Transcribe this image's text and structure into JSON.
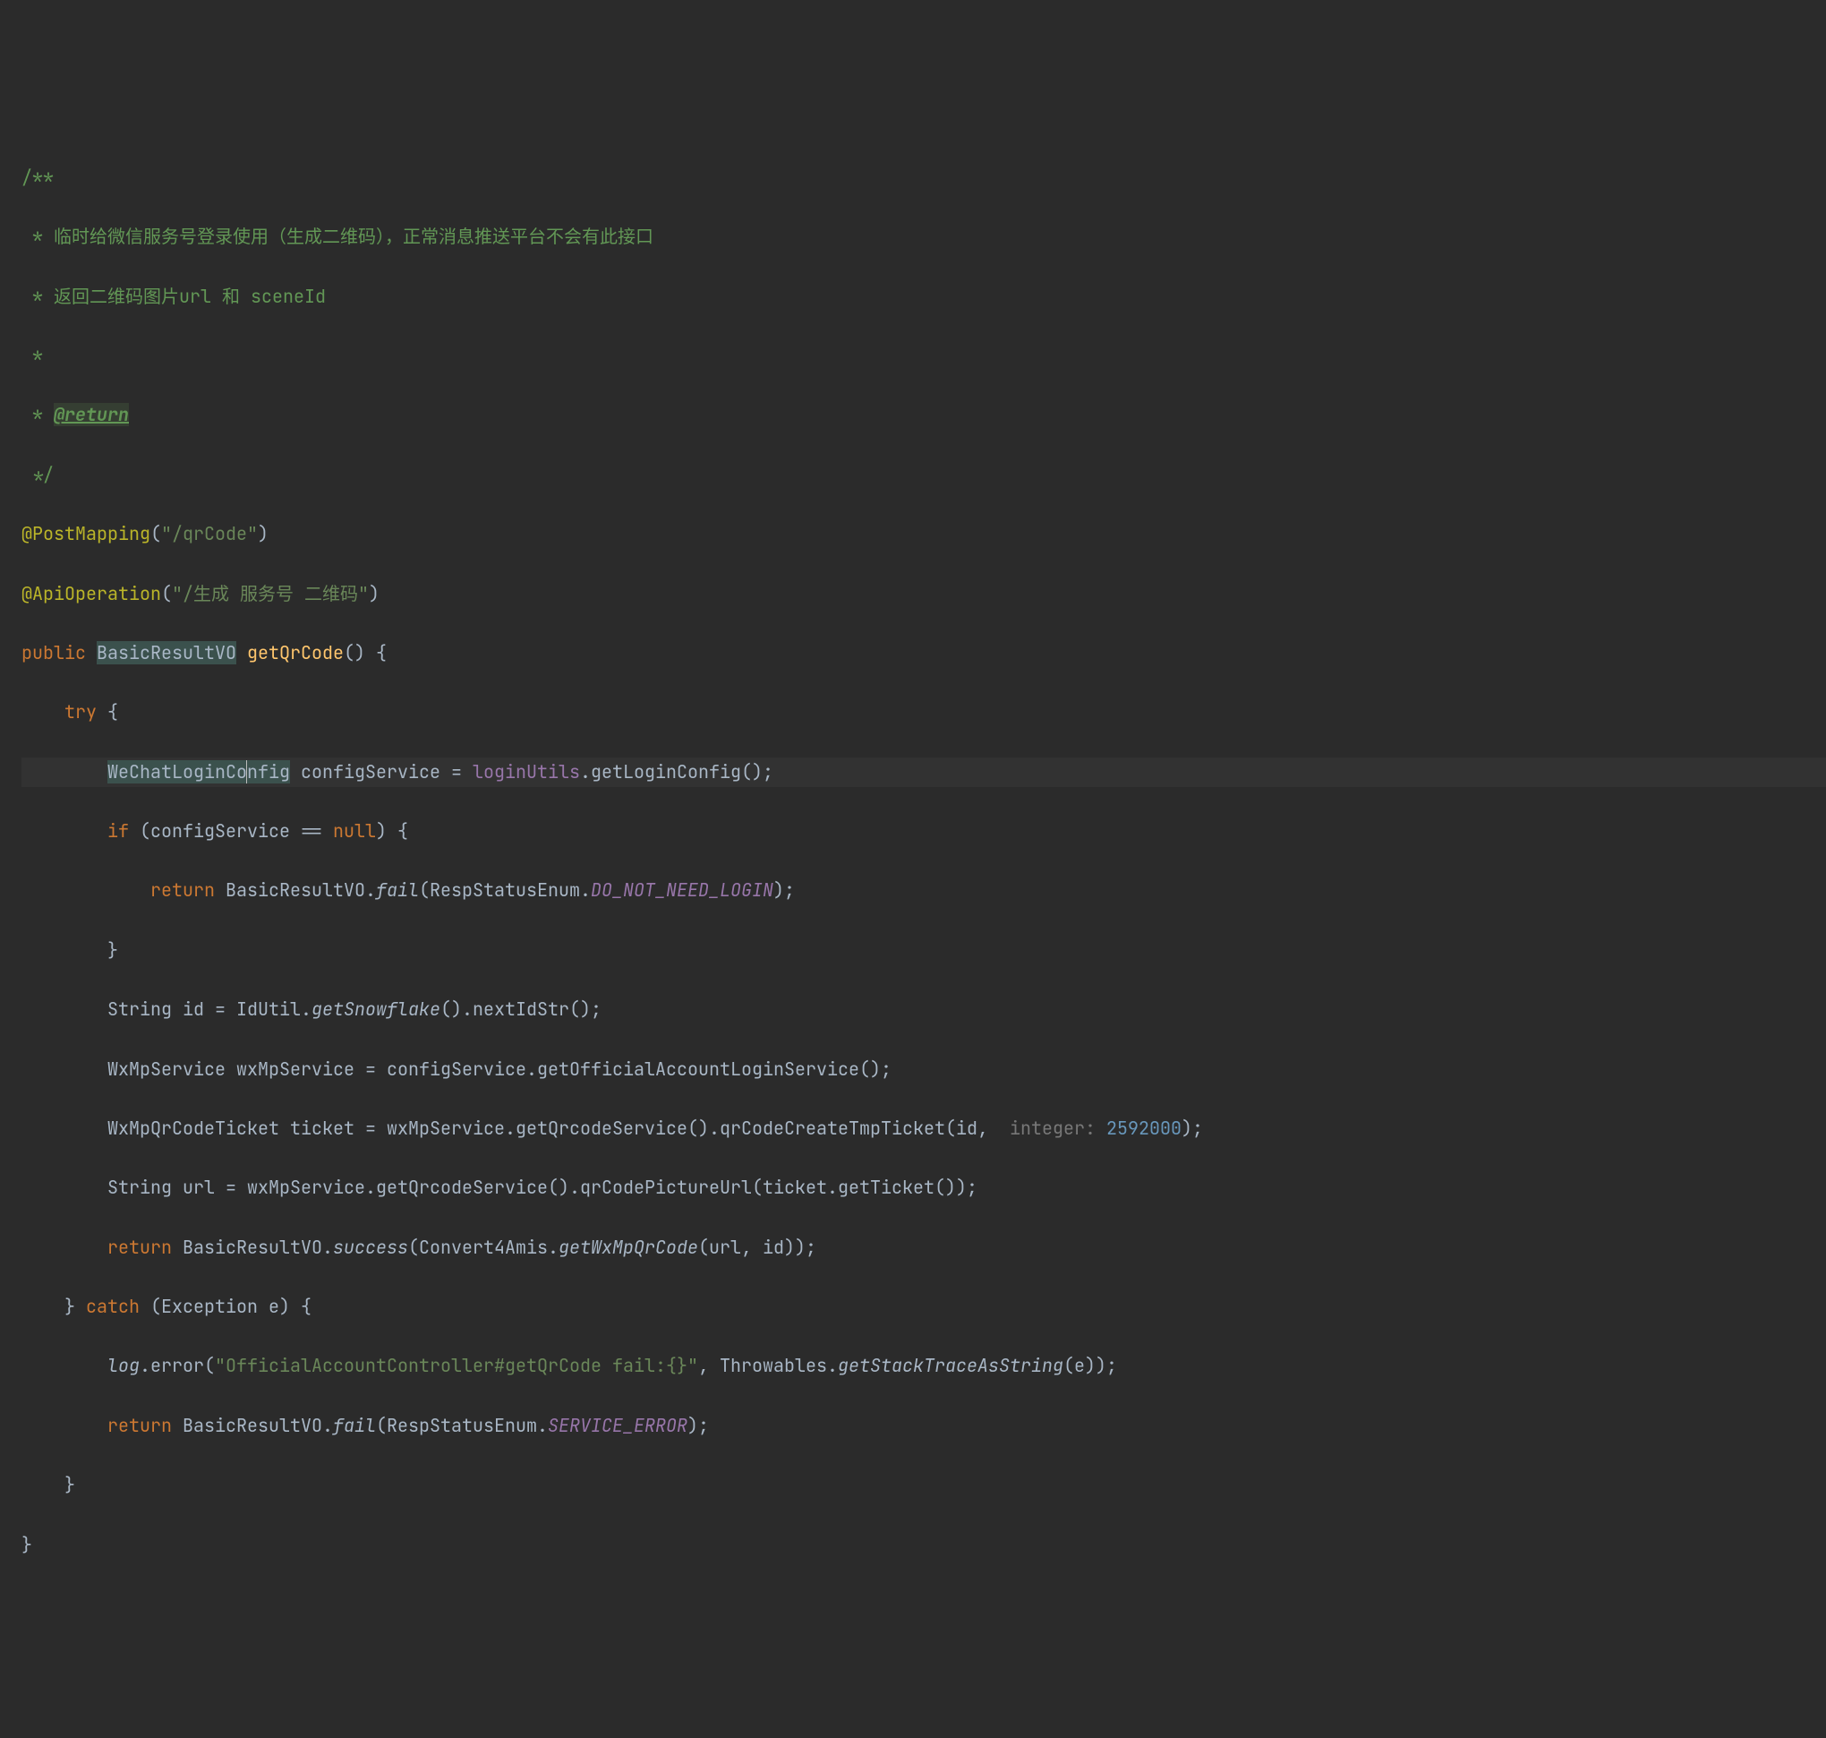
{
  "code": {
    "c1": "/**",
    "c2": " * 临时给微信服务号登录使用（生成二维码），正常消息推送平台不会有此接口",
    "c3": " * 返回二维码图片url 和 sceneId",
    "c4": " *",
    "c5a": " * ",
    "c5_tag": "@return",
    "c6": " */",
    "ann1": "@PostMapping",
    "ann1_lp": "(",
    "ann1_str": "\"/qrCode\"",
    "ann1_rp": ")",
    "ann2": "@ApiOperation",
    "ann2_lp": "(",
    "ann2_str": "\"/生成 服务号 二维码\"",
    "ann2_rp": ")",
    "kw_public": "public ",
    "type_BasicResultVO": "BasicResultVO",
    "sp1": " ",
    "m_getQrCode": "getQrCode",
    "sig_open": "() {",
    "indent1": "    ",
    "kw_try": "try",
    "brace_try": " {",
    "indent2": "        ",
    "type_WeChatLoginConfig_a": "WeChatLoginCo",
    "caret_marker": "",
    "type_WeChatLoginConfig_b": "nfig",
    "sp2": " ",
    "var_configService": "configService ",
    "eq1": "= ",
    "fld_loginUtils": "loginUtils",
    "dot1": ".",
    "call_getLoginConfig": "getLoginConfig();",
    "kw_if": "if ",
    "if_cond": "(configService == ",
    "kw_null": "null",
    "if_close": ") {",
    "indent3": "            ",
    "kw_return": "return ",
    "t_BasicResultVO": "BasicResultVO.",
    "sc_fail": "fail",
    "fail_args_open": "(RespStatusEnum.",
    "enum_DO_NOT_NEED_LOGIN": "DO_NOT_NEED_LOGIN",
    "fail_args_close": ");",
    "brace_close": "}",
    "line_id_a": "String id = IdUtil.",
    "sc_getSnowflake": "getSnowflake",
    "line_id_b": "().nextIdStr();",
    "line_wxsvc": "WxMpService wxMpService = configService.getOfficialAccountLoginService();",
    "line_ticket_a": "WxMpQrCodeTicket ticket = wxMpService.getQrcodeService().qrCodeCreateTmpTicket(id, ",
    "hint_integer": " integer: ",
    "num_2592000": "2592000",
    "line_ticket_b": ");",
    "line_url": "String url = wxMpService.getQrcodeService().qrCodePictureUrl(ticket.getTicket());",
    "kw_return2": "return ",
    "t_BasicResultVO2": "BasicResultVO.",
    "sc_success": "success",
    "succ_open": "(Convert4Amis.",
    "sc_getWxMpQrCode": "getWxMpQrCode",
    "succ_close": "(url, id));",
    "brace_close2": "} ",
    "kw_catch": "catch",
    "catch_args": " (Exception e) {",
    "fld_log": "log",
    "log_dot": ".error(",
    "str_log": "\"OfficialAccountController#getQrCode fail:{}\"",
    "log_mid": ", Throwables.",
    "sc_getStackTraceAsString": "getStackTraceAsString",
    "log_end": "(e));",
    "kw_return3": "return ",
    "t_BasicResultVO3": "BasicResultVO.",
    "sc_fail2": "fail",
    "fail2_open": "(RespStatusEnum.",
    "enum_SERVICE_ERROR": "SERVICE_ERROR",
    "fail2_close": ");",
    "brace_close3": "}",
    "brace_close4": "}"
  }
}
